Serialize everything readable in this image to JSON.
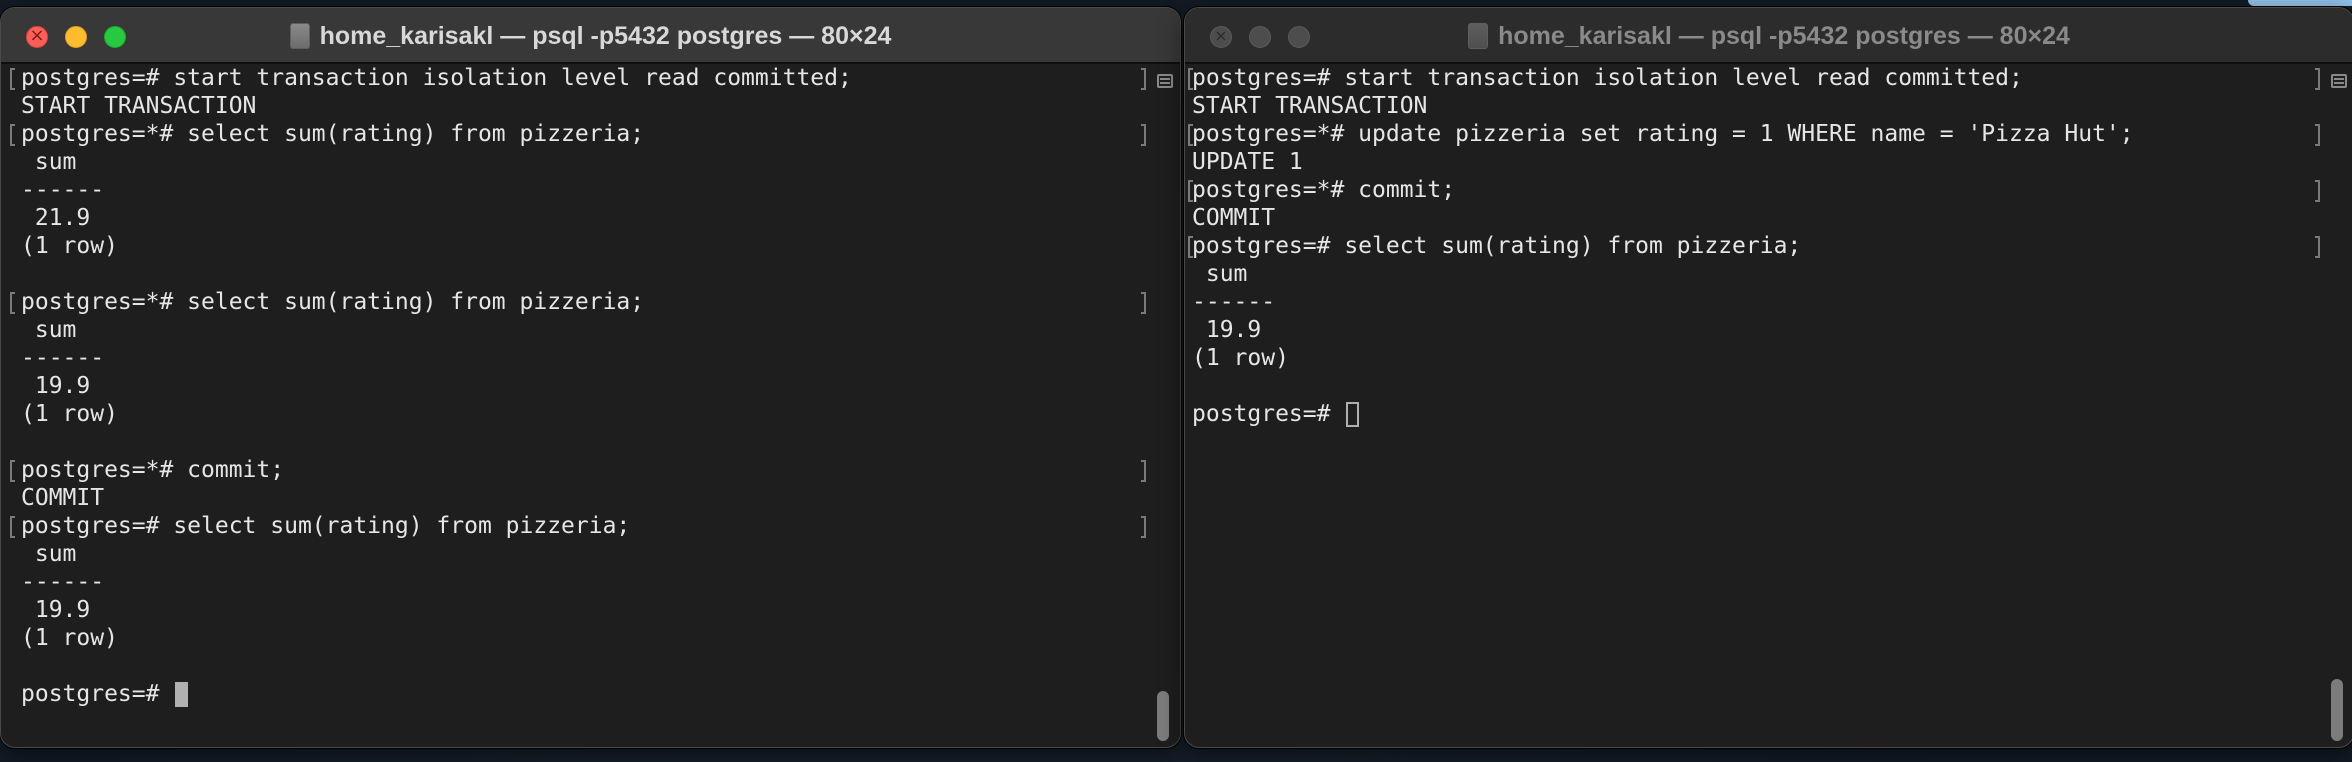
{
  "windows": [
    {
      "title": "home_karisakl — psql -p5432 postgres — 80×24",
      "lines": [
        "postgres=# start transaction isolation level read committed;",
        "START TRANSACTION",
        "postgres=*# select sum(rating) from pizzeria;",
        " sum",
        "------",
        " 21.9",
        "(1 row)",
        "",
        "postgres=*# select sum(rating) from pizzeria;",
        " sum",
        "------",
        " 19.9",
        "(1 row)",
        "",
        "postgres=*# commit;",
        "COMMIT",
        "postgres=# select sum(rating) from pizzeria;",
        " sum",
        "------",
        " 19.9",
        "(1 row)",
        "",
        "postgres=# "
      ]
    },
    {
      "title": "home_karisakl — psql -p5432 postgres — 80×24",
      "lines": [
        "postgres=# start transaction isolation level read committed;",
        "START TRANSACTION",
        "postgres=*# update pizzeria set rating = 1 WHERE name = 'Pizza Hut';",
        "UPDATE 1",
        "postgres=*# commit;",
        "COMMIT",
        "postgres=# select sum(rating) from pizzeria;",
        " sum",
        "------",
        " 19.9",
        "(1 row)",
        "",
        "postgres=# "
      ]
    }
  ],
  "colors": {
    "terminal_bg": "#1e1e1e",
    "text": "#e6e6e6",
    "titlebar_active": "#383838",
    "close": "#ff5f57",
    "minimize": "#febc2e",
    "maximize": "#28c840"
  }
}
